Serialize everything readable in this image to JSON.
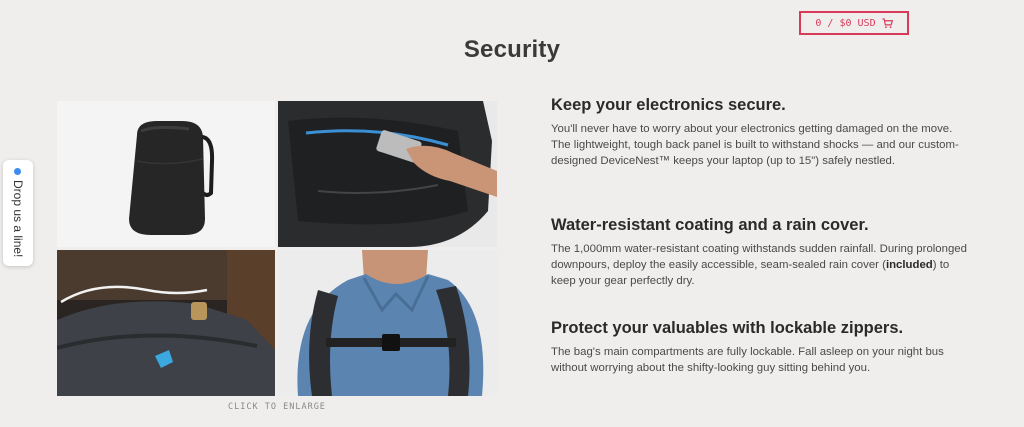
{
  "cart": {
    "label": "0 / $0 USD",
    "icon": "cart-icon",
    "color": "#d83a5a"
  },
  "page": {
    "title": "Security"
  },
  "feedback": {
    "label": "Drop us a line!",
    "dot_color": "#3c8cf0"
  },
  "gallery": {
    "caption": "CLICK TO ENLARGE",
    "images": [
      {
        "name": "backpack-rain-cover-photo"
      },
      {
        "name": "laptop-compartment-photo"
      },
      {
        "name": "lockable-zipper-photo"
      },
      {
        "name": "man-wearing-backpack-photo"
      }
    ]
  },
  "features": [
    {
      "heading": "Keep your electronics secure.",
      "body": "You'll never have to worry about your electronics getting damaged on the move. The lightweight, tough back panel is built to withstand shocks — and our custom-designed DeviceNest™ keeps your laptop (up to 15\") safely nestled."
    },
    {
      "heading": "Water-resistant coating and a rain cover.",
      "body_before": "The 1,000mm water-resistant coating withstands sudden rainfall. During prolonged downpours, deploy the easily accessible, seam-sealed rain cover (",
      "body_bold": "included",
      "body_after": ") to keep your gear perfectly dry."
    },
    {
      "heading": "Protect your valuables with lockable zippers.",
      "body": "The bag's main compartments are fully lockable. Fall asleep on your night bus without worrying about the shifty-looking guy sitting behind you."
    }
  ]
}
